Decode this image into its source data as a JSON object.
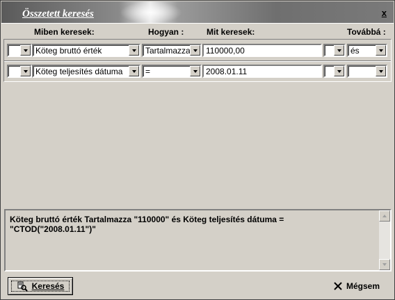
{
  "window": {
    "title": "Összetett keresés",
    "close_label": "x"
  },
  "headers": {
    "field": "Miben keresek:",
    "how": "Hogyan :",
    "what": "Mit keresek:",
    "next": "Továbbá :"
  },
  "rows": [
    {
      "paren_open": "",
      "field": "Köteg bruttó érték",
      "operator": "Tartalmazza",
      "value": "110000,00",
      "paren_close": "",
      "connector": "és"
    },
    {
      "paren_open": "",
      "field": "Köteg teljesítés dátuma",
      "operator": "=",
      "value": "2008.01.11",
      "paren_close": "",
      "connector": ""
    }
  ],
  "query": {
    "text": "Köteg bruttó érték Tartalmazza \"110000\" és  Köteg teljesítés dátuma = \"CTOD(\"2008.01.11\")\""
  },
  "buttons": {
    "search": "Keresés",
    "cancel": "Mégsem"
  },
  "icons": {
    "search_button_icon": "search-icon",
    "cancel_button_icon": "close-icon",
    "combo_arrow": "chevron-down-icon"
  }
}
